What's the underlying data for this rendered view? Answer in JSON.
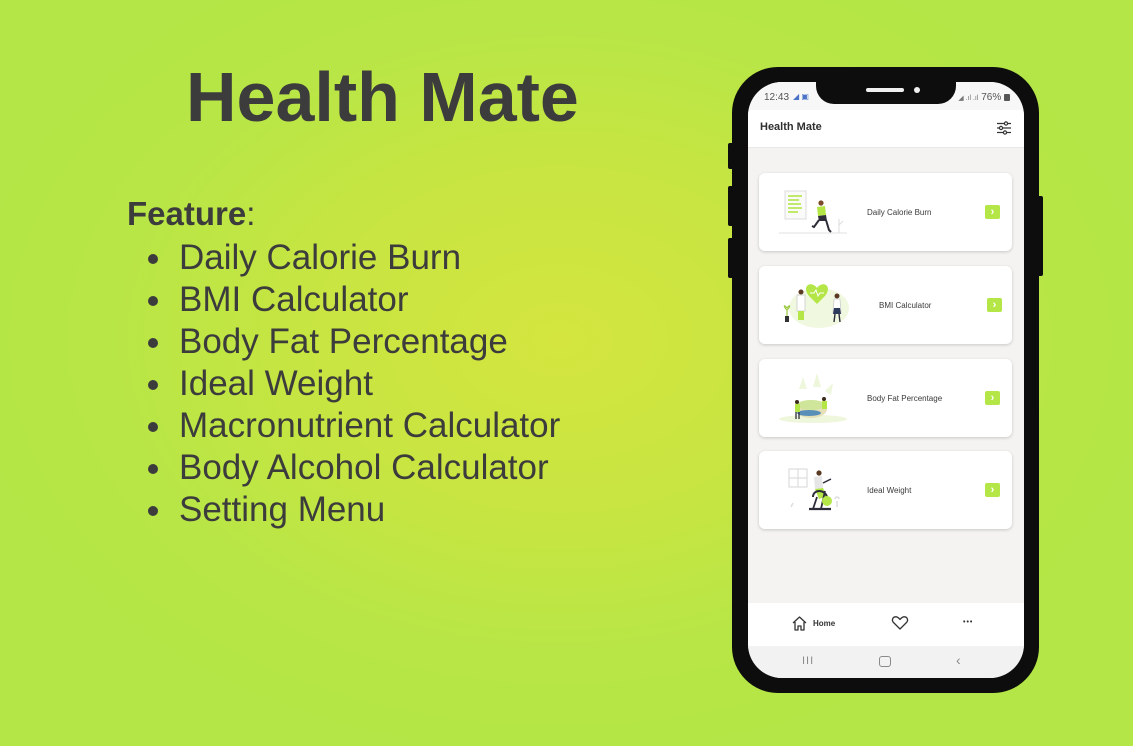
{
  "promo": {
    "title": "Health Mate",
    "feature_heading": "Feature",
    "feature_colon": ":",
    "features": [
      "Daily Calorie Burn",
      "BMI Calculator",
      "Body Fat Percentage",
      "Ideal Weight",
      "Macronutrient Calculator",
      "Body Alcohol Calculator",
      "Setting Menu"
    ]
  },
  "colors": {
    "background": "#b5e646",
    "accent": "#b3e646",
    "text_dark": "#3c3c3c",
    "phone_frame": "#0d0d0d"
  },
  "phone": {
    "status_bar": {
      "time": "12:43",
      "left_icons": "◢ ▣",
      "right_icons": "◢ .ıl .ıl",
      "battery": "76%"
    },
    "app_bar": {
      "title": "Health Mate",
      "action_icon": "settings-sliders-icon"
    },
    "cards": [
      {
        "label": "Daily Calorie Burn",
        "illustration": "runner-illustration",
        "arrow": "›"
      },
      {
        "label": "BMI Calculator",
        "illustration": "doctors-heart-illustration",
        "arrow": "›"
      },
      {
        "label": "Body Fat Percentage",
        "illustration": "salad-bowl-illustration",
        "arrow": "›"
      },
      {
        "label": "Ideal Weight",
        "illustration": "exercise-bike-illustration",
        "arrow": "›"
      }
    ],
    "bottom_nav": {
      "home_label": "Home",
      "items": [
        "home-icon",
        "heart-icon",
        "more-icon"
      ],
      "more_glyph": "•••"
    },
    "system_nav": {
      "recent": "III",
      "back": "‹"
    }
  }
}
